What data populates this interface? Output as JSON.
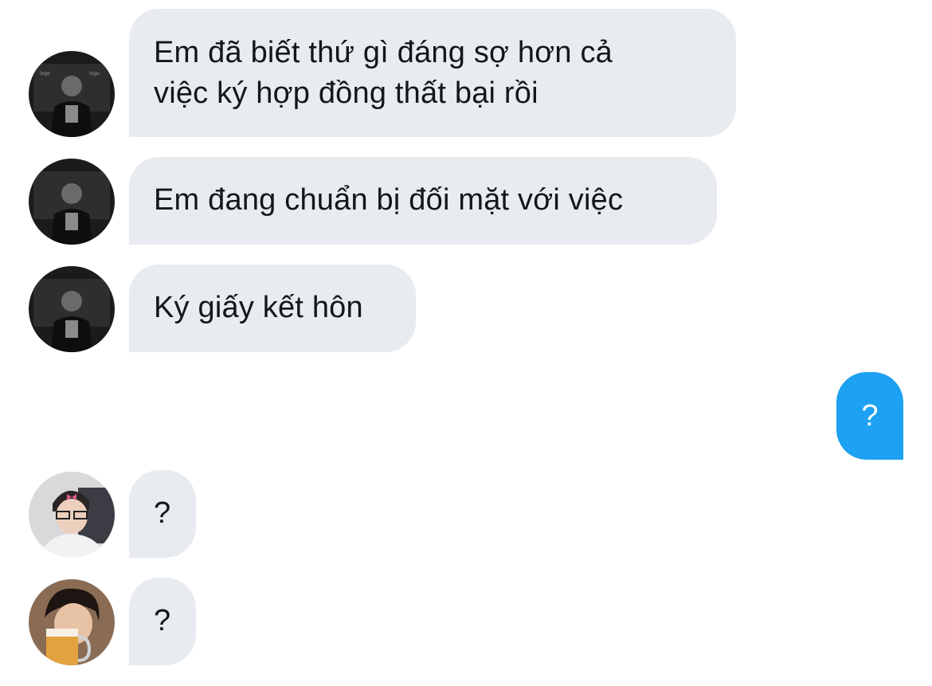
{
  "conversation": {
    "messages": [
      {
        "direction": "incoming",
        "sender_avatar": "avatar-sender-a",
        "lines": [
          "Em đã biết thứ gì đáng sợ hơn cả",
          "việc ký hợp đồng thất bại rồi"
        ]
      },
      {
        "direction": "incoming",
        "sender_avatar": "avatar-sender-a",
        "lines": [
          "Em đang chuẩn bị đối mặt với việc"
        ]
      },
      {
        "direction": "incoming",
        "sender_avatar": "avatar-sender-a",
        "lines": [
          "Ký giấy kết hôn"
        ]
      },
      {
        "direction": "outgoing",
        "lines": [
          "?"
        ]
      },
      {
        "direction": "incoming",
        "sender_avatar": "avatar-sender-b",
        "lines": [
          "?"
        ]
      },
      {
        "direction": "incoming",
        "sender_avatar": "avatar-sender-c",
        "lines": [
          "?"
        ]
      }
    ]
  },
  "colors": {
    "incoming_bubble": "#e8ebef",
    "incoming_text": "#14171a",
    "outgoing_bubble": "#1da1f2",
    "outgoing_text": "#ffffff"
  }
}
